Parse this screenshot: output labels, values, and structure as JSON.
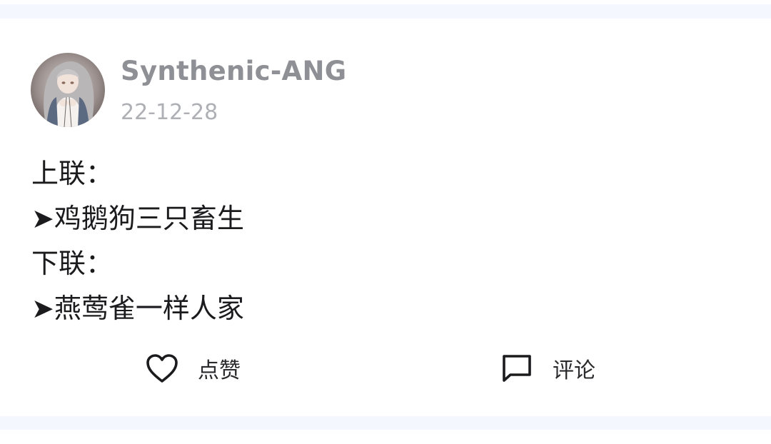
{
  "post": {
    "author": "Synthenic-ANG",
    "date": "22-12-28",
    "lines": [
      "上联：",
      "➤鸡鹅狗三只畜生",
      "下联：",
      "➤燕莺雀一样人家"
    ]
  },
  "actions": {
    "like_label": "点赞",
    "like_icon": "heart-outline-icon",
    "comment_label": "评论",
    "comment_icon": "comment-bubble-icon"
  },
  "colors": {
    "page_bg": "#f4f7fd",
    "card_bg": "#ffffff",
    "author_text": "#8f9095",
    "date_text": "#aeb0b5",
    "body_text": "#1b1b1d"
  }
}
